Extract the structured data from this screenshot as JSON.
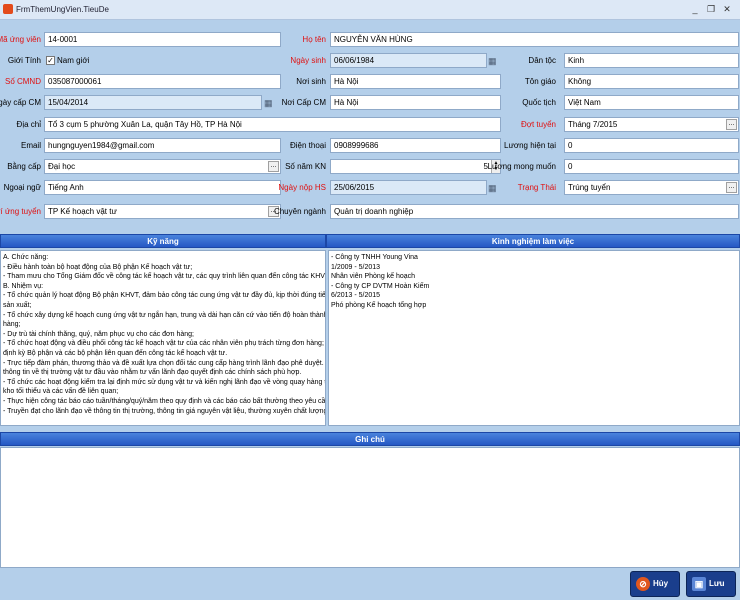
{
  "window": {
    "title": "FrmThemUngVien.TieuDe",
    "controls": [
      "_",
      "❐",
      "✕"
    ]
  },
  "form": {
    "ma_ung_vien": {
      "label": "Mã ứng viên",
      "value": "14-0001"
    },
    "ho_ten": {
      "label": "Họ tên",
      "value": "NGUYỄN VĂN HÙNG"
    },
    "gioi_tinh": {
      "label": "Giới Tính",
      "check_label": "Nam giới",
      "checked": true
    },
    "ngay_sinh": {
      "label": "Ngày sinh",
      "value": "06/06/1984"
    },
    "dan_toc": {
      "label": "Dân tộc",
      "value": "Kinh"
    },
    "so_cmnd": {
      "label": "Số CMND",
      "value": "035087000061"
    },
    "noi_sinh": {
      "label": "Nơi sinh",
      "value": "Hà Nội"
    },
    "ton_giao": {
      "label": "Tôn giáo",
      "value": "Không"
    },
    "ngay_cap_cm": {
      "label": "Ngày cấp CM",
      "value": "15/04/2014"
    },
    "noi_cap_cm": {
      "label": "Nơi Cấp CM",
      "value": "Hà Nội"
    },
    "quoc_tich": {
      "label": "Quốc tịch",
      "value": "Việt Nam"
    },
    "dia_chi": {
      "label": "Địa chỉ",
      "value": "Tổ 3 cụm 5 phường Xuân La, quận Tây Hồ, TP Hà Nội"
    },
    "dot_tuyen": {
      "label": "Đợt tuyển",
      "value": "Tháng 7/2015"
    },
    "email": {
      "label": "Email",
      "value": "hungnguyen1984@gmail.com"
    },
    "dien_thoai": {
      "label": "Điện thoại",
      "value": "0908999686"
    },
    "luong_hien_tai": {
      "label": "Lương hiện tại",
      "value": "0"
    },
    "bang_cap": {
      "label": "Bằng cấp",
      "value": "Đại học"
    },
    "so_nam_kn": {
      "label": "Số năm KN",
      "value": "5"
    },
    "luong_mong_muon": {
      "label": "Lương mong muốn",
      "value": "0"
    },
    "ngoai_ngu": {
      "label": "Ngoại ngữ",
      "value": "Tiếng Anh"
    },
    "ngay_nop_hs": {
      "label": "Ngày nộp HS",
      "value": "25/06/2015"
    },
    "trang_thai": {
      "label": "Trạng Thái",
      "value": "Trúng tuyển"
    },
    "vi_tri": {
      "label": "Vị trí ứng tuyển",
      "value": "TP Kế hoạch vật tư"
    },
    "chuyen_nganh": {
      "label": "Chuyên ngành",
      "value": "Quản trị doanh nghiệp"
    }
  },
  "sections": {
    "ky_nang": "Kỹ năng",
    "kinh_nghiem": "Kinh nghiệm làm việc",
    "ghi_chu": "Ghi chú"
  },
  "ky_nang_lines": [
    "A. Chức năng:",
    "- Điều hành toàn bộ hoạt động của Bộ phận Kế hoạch vật tư;",
    "- Tham mưu cho Tổng Giám đốc về công tác kế hoạch vật tư, các quy trình liên quan đến công tác KHVT.",
    "B. Nhiệm vụ:",
    "- Tổ chức quản lý hoạt động Bộ phận KHVT, đảm bảo công tác cung ứng vật tư đầy đủ, kịp thời đúng tiến độ phục vụ cho",
    "sản xuất;",
    "- Tổ chức xây dựng kế hoạch cung ứng vật tư ngắn hạn, trung và dài hạn căn cứ vào tiến độ hoàn thành của các đơn",
    "hàng;",
    "- Dự trù tài chính thăng, quý, năm phục vụ cho các đơn hàng;",
    "- Tổ chức hoạt động và điều phối công tác kế hoạch vật tư của các nhân viên phụ trách từng đơn hàng; Tổ chức cuộc họp",
    "định kỳ Bộ phận và các bộ phận liên quan đến công tác kế hoạch vật tư.",
    "- Trực tiếp đàm phán, thương thảo và đề xuất lựa chọn đối tác cung cấp hàng trình lãnh đạo phê duyệt. Thường xuyên",
    "thông tin về thị trường vật tư đầu vào nhằm tư vấn lãnh đạo quyết định các chính sách phù hợp.",
    "- Tổ chức các hoạt động kiểm tra lại định mức sử dụng vật tư và kiến nghị lãnh đạo về vòng quay hàng tồn kho, mức tồn",
    "kho tối thiểu và các vấn đề liên quan;",
    "- Thực hiện công tác báo cáo tuần/tháng/quý/năm theo quy định và các báo cáo bất thường theo yêu cầu của lãnh đạo;",
    "- Truyền đạt cho lãnh đạo về thông tin thị trường, thông tin giá nguyên vật liệu, thường xuyên chất lượng vật tư..."
  ],
  "kinh_nghiem_lines": [
    "- Công ty TNHH Young Vina",
    "1/2009 - 5/2013",
    "Nhân viên Phòng kế hoạch",
    "- Công ty CP DVTM Hoàn Kiếm",
    "6/2013 - 5/2015",
    "Phó phòng Kế hoạch tổng hợp"
  ],
  "buttons": {
    "huy": "Hủy",
    "luu": "Lưu"
  },
  "colors": {
    "background": "#b4cfea",
    "section_header": "#2f66d0",
    "required_label": "#e01010"
  }
}
